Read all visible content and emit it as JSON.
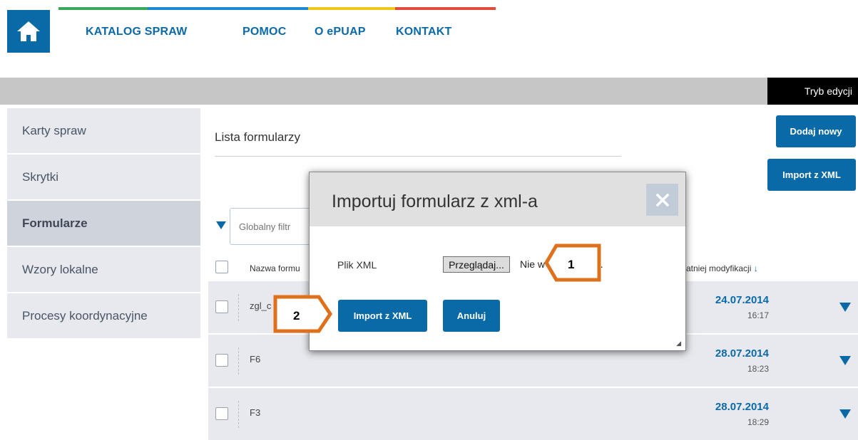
{
  "header": {
    "home_icon": "home-icon",
    "nav": [
      {
        "label": "KATALOG SPRAW"
      },
      {
        "label": "POMOC"
      },
      {
        "label": "O ePUAP"
      },
      {
        "label": "KONTAKT"
      }
    ],
    "stripe_colors": [
      "#3aaa5a",
      "#1f88d1",
      "#f0c419",
      "#e24a3b"
    ]
  },
  "toolbar": {
    "mode_label": "Tryb edycji"
  },
  "sidebar": {
    "items": [
      {
        "label": "Karty spraw"
      },
      {
        "label": "Skrytki"
      },
      {
        "label": "Formularze",
        "active": true
      },
      {
        "label": "Wzory lokalne"
      },
      {
        "label": "Procesy koordynacyjne"
      }
    ]
  },
  "main": {
    "title": "Lista formularzy",
    "add_button": "Dodaj nowy",
    "import_button": "Import z XML",
    "filter_placeholder": "Globalny filtr",
    "columns": {
      "name": "Nazwa formu",
      "modified": "atniej modyfikacji",
      "sort_icon": "arrow-down-icon"
    },
    "rows": [
      {
        "name": "zgl_c",
        "date": "24.07.2014",
        "time": "16:17"
      },
      {
        "name": "F6",
        "date": "28.07.2014",
        "time": "18:23"
      },
      {
        "name": "F3",
        "date": "28.07.2014",
        "time": "18:29"
      }
    ]
  },
  "modal": {
    "title": "Importuj formularz z xml-a",
    "file_label": "Plik XML",
    "browse_button": "Przeglądaj...",
    "no_file_text_left": "Nie w",
    "no_file_text_right": "ku.",
    "import_button": "Import z XML",
    "cancel_button": "Anuluj",
    "close_icon": "close-icon"
  },
  "annotations": {
    "callout_1": "1",
    "callout_2": "2",
    "callout_color": "#e0711c"
  }
}
